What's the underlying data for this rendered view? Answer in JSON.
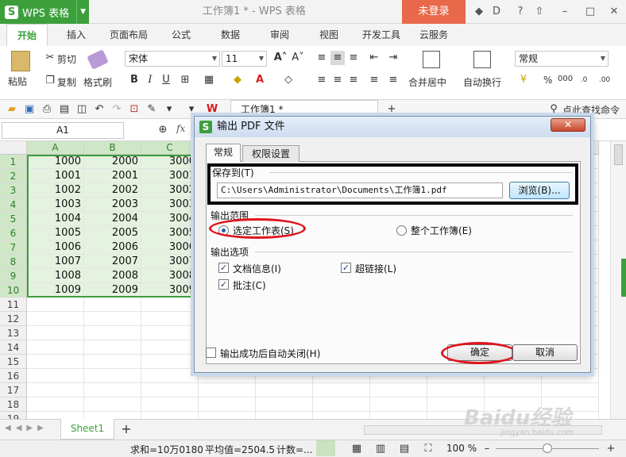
{
  "app": {
    "name": "WPS 表格",
    "doc_title": "工作簿1 * - WPS 表格",
    "login": "未登录"
  },
  "ribbon_tabs": [
    "开始",
    "插入",
    "页面布局",
    "公式",
    "数据",
    "审阅",
    "视图",
    "开发工具",
    "云服务"
  ],
  "ribbon": {
    "paste": "粘贴",
    "cut": "剪切",
    "copy": "复制",
    "format_painter": "格式刷",
    "font_name": "宋体",
    "font_size": "11",
    "merge_center": "合并居中",
    "wrap_text": "自动换行",
    "number_format": "常规",
    "percent": "%",
    "comma": "000"
  },
  "doc_tab": "工作簿1 *",
  "search_command": "点此查找命令",
  "formula_bar": {
    "name_box": "A1",
    "fx": "fx"
  },
  "grid": {
    "columns": [
      "A",
      "B",
      "C"
    ],
    "rows": [
      "1",
      "2",
      "3",
      "4",
      "5",
      "6",
      "7",
      "8",
      "9",
      "10",
      "11",
      "12",
      "13",
      "14",
      "15",
      "16",
      "17",
      "18",
      "19"
    ],
    "col_a": [
      "1000",
      "1001",
      "1002",
      "1003",
      "1004",
      "1005",
      "1006",
      "1007",
      "1008",
      "1009"
    ],
    "col_b": [
      "2000",
      "2001",
      "2002",
      "2003",
      "2004",
      "2005",
      "2006",
      "2007",
      "2008",
      "2009"
    ],
    "col_c": [
      "3000",
      "3001",
      "3002",
      "3003",
      "3004",
      "3005",
      "3006",
      "3007",
      "3008",
      "3009"
    ]
  },
  "sheet_tab": "Sheet1",
  "status": {
    "sum": "求和=10万0180",
    "avg": "平均值=2504.5",
    "count": "计数=...",
    "zoom": "100 %"
  },
  "dialog": {
    "title": "输出 PDF 文件",
    "tabs": [
      "常规",
      "权限设置"
    ],
    "save_to_label": "保存到(T)",
    "path": "C:\\Users\\Administrator\\Documents\\工作簿1.pdf",
    "browse": "浏览(B)...",
    "range_label": "输出范围",
    "range_selected": "选定工作表(S)",
    "range_all": "整个工作簿(E)",
    "options_label": "输出选项",
    "opt_docinfo": "文档信息(I)",
    "opt_hyperlink": "超链接(L)",
    "opt_comments": "批注(C)",
    "auto_close": "输出成功后自动关闭(H)",
    "ok": "确定",
    "cancel": "取消"
  },
  "watermark": {
    "main": "Baidu经验",
    "sub": "jingyan.baidu.com"
  },
  "colors": {
    "accent": "#3c9f3c",
    "login": "#e8694a",
    "highlight": "#e0141e"
  }
}
